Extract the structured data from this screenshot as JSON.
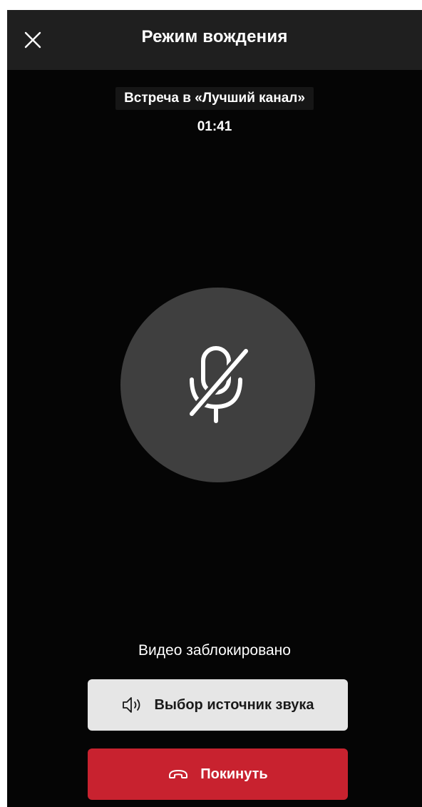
{
  "header": {
    "title": "Режим вождения",
    "close_icon": "close-icon"
  },
  "meeting": {
    "name": "Встреча в «Лучший канал»",
    "timer": "01:41"
  },
  "mic": {
    "icon": "microphone-off-icon",
    "state": "muted"
  },
  "video": {
    "status": "Видео заблокировано"
  },
  "buttons": {
    "audio_source": {
      "label": "Выбор источник звука",
      "icon": "speaker-icon"
    },
    "leave": {
      "label": "Покинуть",
      "icon": "hang-up-icon"
    }
  },
  "colors": {
    "background": "#050505",
    "header": "#1f1f1f",
    "mic_circle": "#3f3f3f",
    "audio_button": "#e6e6e6",
    "leave_button": "#c8222f"
  }
}
